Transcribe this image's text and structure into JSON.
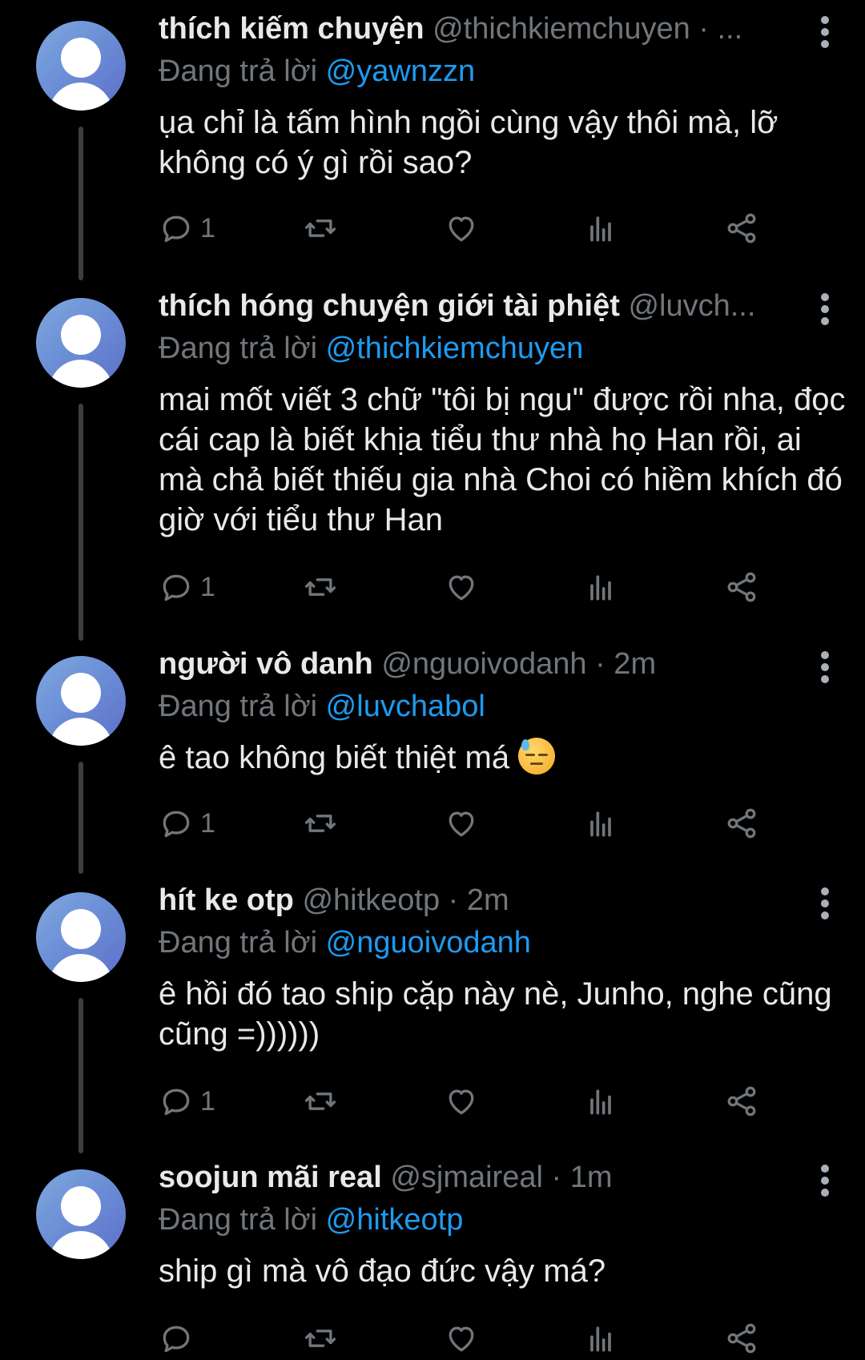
{
  "tweets": [
    {
      "name": "thích kiếm chuyện",
      "handle": "@thichkiemchuyen · ...",
      "reply_prefix": "Đang trả lời ",
      "reply_to": "@yawnzzn",
      "text": "ụa chỉ là tấm hình ngồi cùng vậy thôi mà, lỡ không có ý gì rồi sao?",
      "reply_count": "1"
    },
    {
      "name": "thích hóng chuyện giới tài phiệt",
      "handle": "@luvch...",
      "reply_prefix": "Đang trả lời ",
      "reply_to": "@thichkiemchuyen",
      "text": "mai mốt viết 3 chữ \"tôi bị ngu\" được rồi nha, đọc cái cap là biết khịa tiểu thư nhà họ Han rồi, ai mà chả biết thiếu gia nhà Choi có hiềm khích đó giờ với tiểu thư Han",
      "reply_count": "1"
    },
    {
      "name": "người vô danh",
      "handle": "@nguoivodanh · 2m",
      "reply_prefix": "Đang trả lời ",
      "reply_to": "@luvchabol",
      "text": "ê tao không biết thiệt má",
      "reply_count": "1"
    },
    {
      "name": "hít ke otp",
      "handle": "@hitkeotp · 2m",
      "reply_prefix": "Đang trả lời ",
      "reply_to": "@nguoivodanh",
      "text": "ê hồi đó tao ship cặp này nè, Junho, nghe cũng cũng =))))))",
      "reply_count": "1"
    },
    {
      "name": "soojun mãi real",
      "handle": "@sjmaireal · 1m",
      "reply_prefix": "Đang trả lời ",
      "reply_to": "@hitkeotp",
      "text": "ship gì mà vô đạo đức vậy má?",
      "reply_count": ""
    }
  ],
  "icons": {
    "reply": "reply-icon",
    "retweet": "retweet-icon",
    "like": "like-icon",
    "views": "views-icon",
    "share": "share-icon",
    "more": "more-icon",
    "emoji": "sad-sweat-emoji"
  },
  "colors": {
    "background": "#000000",
    "primary_text": "#e7e9ea",
    "secondary_text": "#71767b",
    "mention": "#1d9bf0"
  }
}
